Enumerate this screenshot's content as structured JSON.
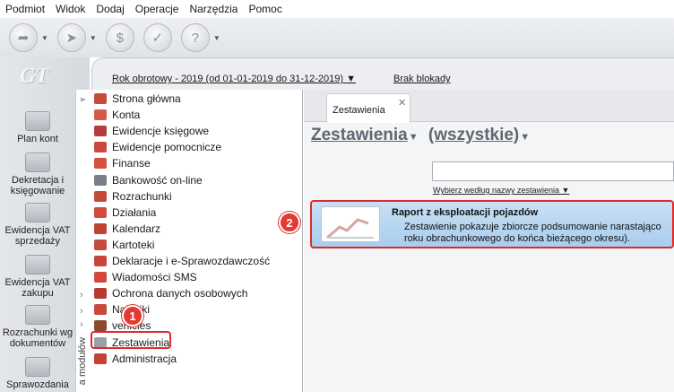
{
  "menu": [
    "Podmiot",
    "Widok",
    "Dodaj",
    "Operacje",
    "Narzędzia",
    "Pomoc"
  ],
  "toolbar": {
    "buttons": [
      {
        "icon": "back-arrow-icon"
      },
      {
        "icon": "forward-arrow-icon"
      },
      {
        "icon": "coins-icon"
      },
      {
        "icon": "checklist-icon"
      },
      {
        "icon": "help-bubble-icon"
      }
    ]
  },
  "logo_text": "GT",
  "info": {
    "year": "Rok obrotowy - 2019  (od 01-01-2019 do 31-12-2019)",
    "lock": "Brak blokady"
  },
  "left_nav": [
    {
      "label": "Plan kont",
      "icon": "chart-of-accounts-icon"
    },
    {
      "label": "Dekretacja i księgowanie",
      "icon": "posting-icon"
    },
    {
      "label": "Ewidencja VAT sprzedaży",
      "icon": "vat-sales-icon"
    },
    {
      "label": "Ewidencja VAT zakupu",
      "icon": "vat-purchase-icon"
    },
    {
      "label": "Rozrachunki wg dokumentów",
      "icon": "settlements-icon"
    },
    {
      "label": "Sprawozdania",
      "icon": "reports-icon"
    }
  ],
  "modules_label": "a modułów",
  "modules": [
    {
      "label": "Strona główna",
      "color": "#c94a3a"
    },
    {
      "label": "Konta",
      "color": "#d65a4a"
    },
    {
      "label": "Ewidencje księgowe",
      "color": "#b63d3d"
    },
    {
      "label": "Ewidencje pomocnicze",
      "color": "#c9493c"
    },
    {
      "label": "Finanse",
      "color": "#d4503f"
    },
    {
      "label": "Bankowość on-line",
      "color": "#7a7f87"
    },
    {
      "label": "Rozrachunki",
      "color": "#c44a3c"
    },
    {
      "label": "Działania",
      "color": "#cf4c3e"
    },
    {
      "label": "Kalendarz",
      "color": "#c14336"
    },
    {
      "label": "Kartoteki",
      "color": "#c54b40"
    },
    {
      "label": "Deklaracje i e-Sprawozdawczość",
      "color": "#c74639"
    },
    {
      "label": "Wiadomości SMS",
      "color": "#d4473b"
    },
    {
      "label": "Ochrona danych osobowych",
      "color": "#b73a34"
    },
    {
      "label": "Naklejki",
      "color": "#c94a3a"
    },
    {
      "label": "vehicles",
      "color": "#8b4a2f"
    },
    {
      "label": "Zestawienia",
      "color": "#9aa0a8"
    },
    {
      "label": "Administracja",
      "color": "#c14336"
    }
  ],
  "tab": {
    "label": "Zestawienia",
    "close": "✕"
  },
  "content": {
    "title": "Zestawienia",
    "filter": "(wszystkie)",
    "search_value": "",
    "search_hint": "Wybierz według nazwy zestawienia"
  },
  "report": {
    "title": "Raport z eksploatacji pojazdów",
    "description": "Zestawienie pokazuje zbiorcze podsumowanie narastająco roku obrachunkowego do końca bieżącego okresu)."
  },
  "annotations": [
    "1",
    "2"
  ]
}
